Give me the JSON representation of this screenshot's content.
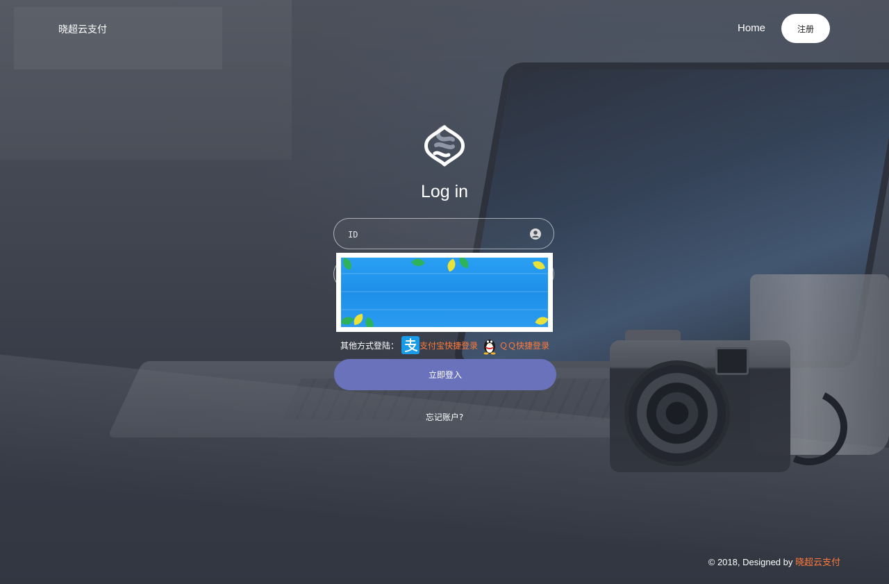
{
  "header": {
    "brand": "晓超云支付",
    "nav_home": "Home",
    "nav_register": "注册"
  },
  "login": {
    "title": "Log in",
    "id_placeholder": "ID",
    "other_methods_label": "其他方式登陆：",
    "alipay_link": "支付宝快捷登录",
    "qq_link": "ＱＱ快捷登录",
    "submit_label": "立即登入",
    "forgot_label": "忘记账户?"
  },
  "footer": {
    "copyright": "© 2018, Designed by ",
    "brand_link": "晓超云支付"
  },
  "icons": {
    "logo": "diamond-knot-logo-icon",
    "user": "user-circle-icon",
    "alipay": "alipay-icon",
    "qq": "qq-penguin-icon"
  },
  "colors": {
    "accent": "#ff7a3a",
    "button": "#6a72bb",
    "captcha_blue": "#1e8fe9"
  }
}
